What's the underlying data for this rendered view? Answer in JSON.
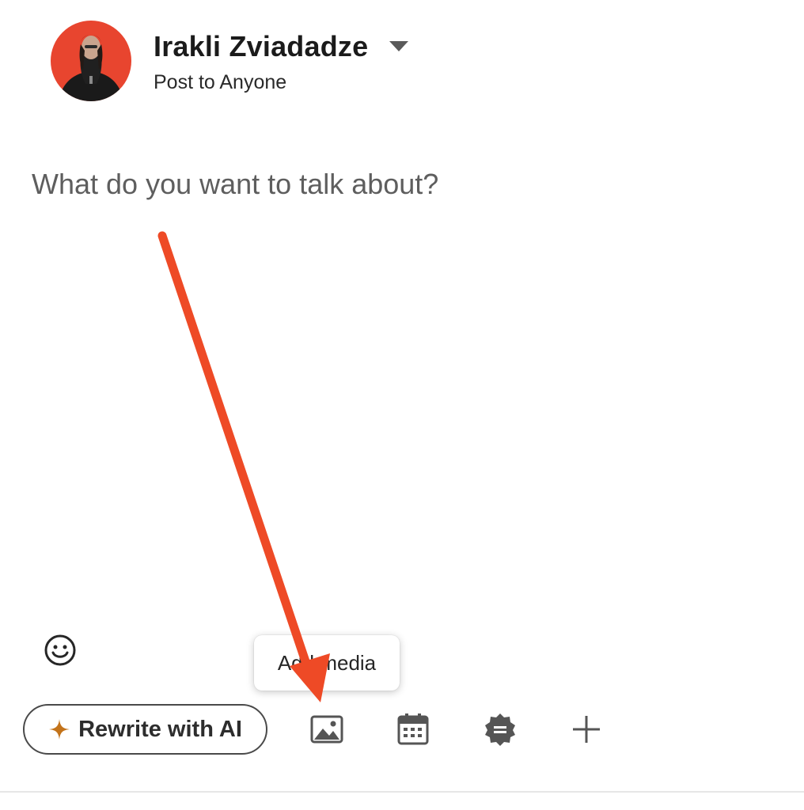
{
  "author": {
    "name": "Irakli Zviadadze",
    "audience": "Post to Anyone",
    "avatar_bg": "#e8452f"
  },
  "composer": {
    "placeholder": "What do you want to talk about?"
  },
  "icons": {
    "audience_toggle": "chevron-down-icon",
    "emoji": "smiley-icon",
    "ai_spark": "sparkle-icon",
    "media": "image-icon",
    "event": "calendar-icon",
    "celebrate": "badge-icon",
    "more": "plus-icon"
  },
  "tooltip": {
    "text": "Add media"
  },
  "toolbar": {
    "ai_label": "Rewrite with AI",
    "ai_accent": "#c3731a"
  },
  "annotation": {
    "arrow_color": "#ee4a26"
  }
}
